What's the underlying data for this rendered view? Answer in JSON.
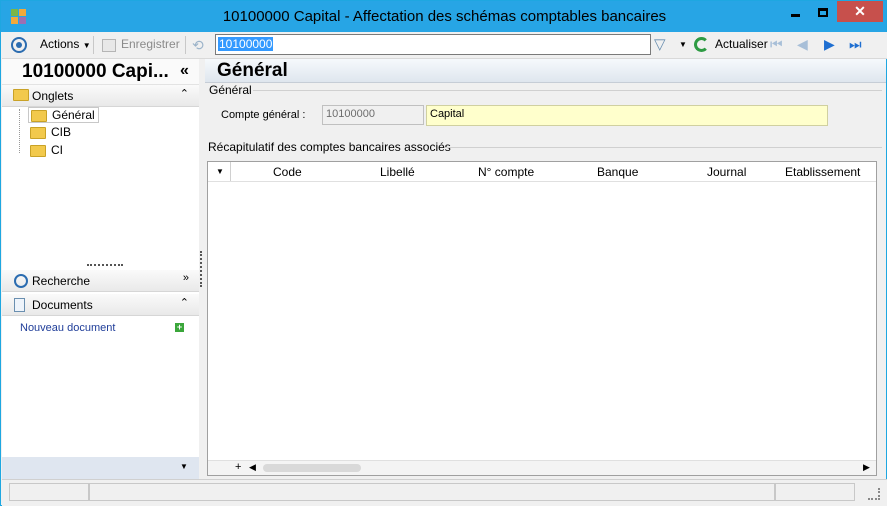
{
  "window": {
    "title": "10100000 Capital -  Affectation des schémas comptables bancaires",
    "minimize": "▬",
    "maximize": "☐",
    "close": "✕"
  },
  "toolbar": {
    "actions_label": "Actions",
    "save_label": "Enregistrer",
    "search_value": "10100000",
    "refresh_label": "Actualiser"
  },
  "left_panel": {
    "title": "10100000 Capi...",
    "collapse": "«",
    "tabs_header": "Onglets",
    "tabs": [
      "Général",
      "CIB",
      "CI"
    ],
    "search_header": "Recherche",
    "documents_header": "Documents",
    "new_document": "Nouveau document"
  },
  "main": {
    "heading": "Général",
    "section_general": "Général",
    "account_label": "Compte général :",
    "account_code": "10100000",
    "account_name": "Capital",
    "summary_header": "Récapitulatif des comptes bancaires associés",
    "columns": [
      "Code",
      "Libellé",
      "N° compte",
      "Banque",
      "Journal",
      "Etablissement"
    ]
  },
  "icons": {
    "accent": "#27a5e5"
  }
}
